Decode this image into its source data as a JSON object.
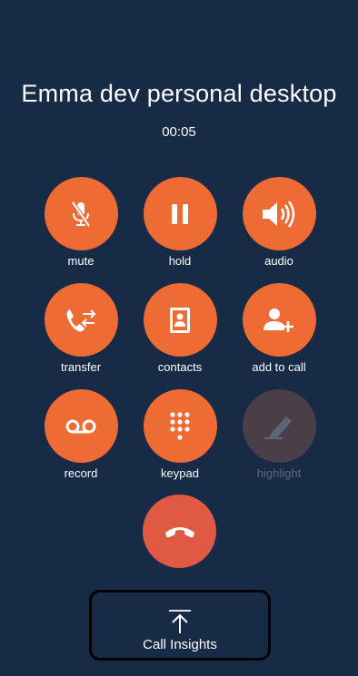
{
  "call": {
    "caller_name": "Emma dev personal desktop",
    "duration": "00:05"
  },
  "controls": [
    {
      "label": "mute",
      "icon": "mic-muted-icon",
      "enabled": true
    },
    {
      "label": "hold",
      "icon": "pause-icon",
      "enabled": true
    },
    {
      "label": "audio",
      "icon": "speaker-icon",
      "enabled": true
    },
    {
      "label": "transfer",
      "icon": "transfer-icon",
      "enabled": true
    },
    {
      "label": "contacts",
      "icon": "contacts-book-icon",
      "enabled": true
    },
    {
      "label": "add to call",
      "icon": "add-person-icon",
      "enabled": true
    },
    {
      "label": "record",
      "icon": "voicemail-icon",
      "enabled": true
    },
    {
      "label": "keypad",
      "icon": "keypad-icon",
      "enabled": true
    },
    {
      "label": "highlight",
      "icon": "pen-icon",
      "enabled": false
    }
  ],
  "hangup": {
    "icon": "hang-up-icon"
  },
  "call_insights": {
    "label": "Call Insights",
    "icon": "arrow-up-to-line-icon"
  },
  "colors": {
    "background": "#172a46",
    "button": "#ee6b33",
    "hangup": "#e05943",
    "disabled_button": "#4a3f48",
    "disabled_label": "#5e6677"
  }
}
